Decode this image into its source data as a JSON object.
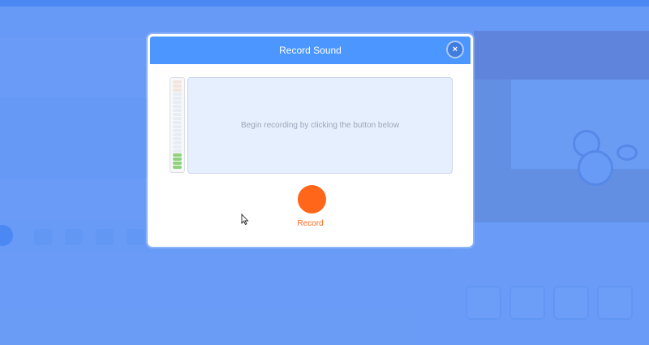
{
  "dialog": {
    "title": "Record Sound",
    "close_icon": "close-icon",
    "close_glyph": "×",
    "placeholder_text": "Begin recording by clicking the button below",
    "record_label": "Record",
    "level_meter": {
      "segments": 22,
      "active_segments": 4
    }
  },
  "colors": {
    "header": "#4c97ff",
    "record": "#ff661a",
    "overlay": "#4c89f5",
    "meter_active": "#8fd27b"
  }
}
